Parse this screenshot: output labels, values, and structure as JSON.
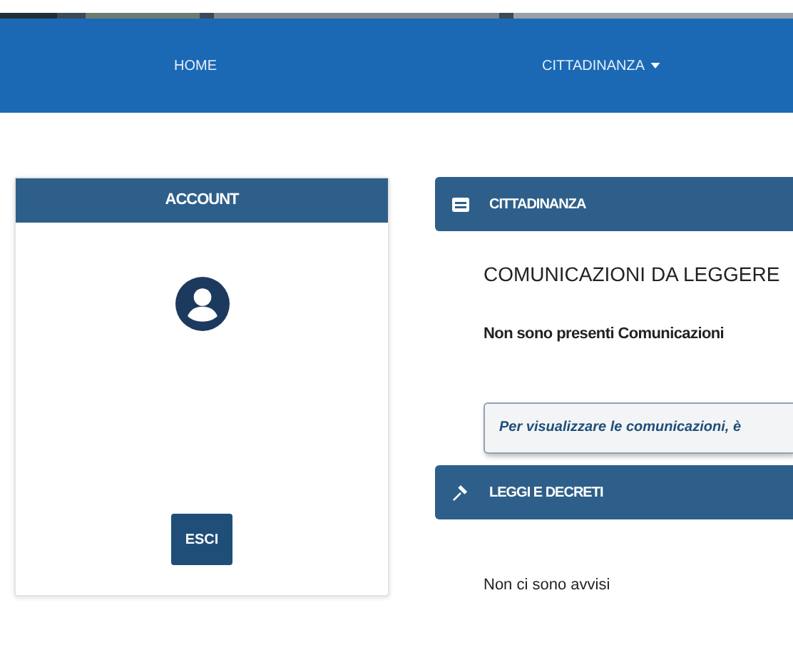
{
  "nav": {
    "items": [
      {
        "label": "HOME",
        "dropdown": false
      },
      {
        "label": "CITTADINANZA",
        "dropdown": true
      }
    ]
  },
  "account": {
    "title": "ACCOUNT",
    "button": "ESCI"
  },
  "sections": [
    {
      "title": "CITTADINANZA",
      "kind": "messages",
      "subtitle": "COMUNICAZIONI DA LEGGERE",
      "message": "Non sono presenti Comunicazioni",
      "note": "Per visualizzare le comunicazioni, è"
    },
    {
      "title": "LEGGI E DECRETI",
      "kind": "laws",
      "message": "Non ci sono avvisi"
    }
  ]
}
